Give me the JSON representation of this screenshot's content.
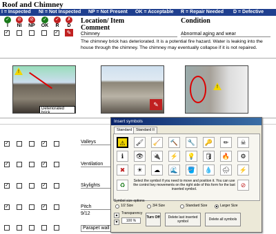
{
  "title": "Roof and Chimney",
  "legend": [
    "I = Inspected",
    "NI = Not Inspected",
    "NP = Not Present",
    "OK = Acceptable",
    "R = Repair Needed",
    "D = Defective"
  ],
  "codes": [
    {
      "label": "I",
      "color": "#1a7a1a",
      "glyph": "✓"
    },
    {
      "label": "NI",
      "color": "#c02020",
      "glyph": "⊘"
    },
    {
      "label": "NP",
      "color": "#c02020",
      "glyph": "⊘"
    },
    {
      "label": "OK",
      "color": "#1a7a1a",
      "glyph": "✓"
    },
    {
      "label": "R",
      "color": "#c02020",
      "glyph": "✓"
    },
    {
      "label": "D",
      "color": "#c02020",
      "glyph": "✗"
    }
  ],
  "headers": {
    "location": "Location/ Item",
    "condition": "Condition",
    "comment": "Comment"
  },
  "first_item": {
    "location": "Chimney",
    "condition": "Abnormal aging and wear",
    "comment": "The chimney brick has deteriorated. It is a potential fire hazard. Water is leaking into the house through the chimney. The chimney may eventually collapse if it is not repaired."
  },
  "photo_caption": "Deteriorated brick",
  "rows": [
    {
      "label": "Valleys",
      "sub": ""
    },
    {
      "label": "Ventilation",
      "sub": ""
    },
    {
      "label": "Skylights",
      "sub": ""
    },
    {
      "label": "Pitch",
      "sub": "9/12"
    }
  ],
  "parapet": "Parapet wall",
  "dialog": {
    "title": "Insert symbols",
    "tabs": [
      "Standard I",
      "Standard II"
    ],
    "instruction": "Select the symbol if you need to move and position it. You can use the control key movements on the right side of this form for the last inserted symbol.",
    "size_label": "Symbol size options",
    "sizes": [
      "1/2 Size",
      "3/4 Size",
      "Standard Size",
      "Larger Size"
    ],
    "selected_size": "Larger Size",
    "transparency_label": "Transparency",
    "transparency_value": "100 %",
    "turn_off": "Turn Off",
    "delete_last": "Delete last inserted symbol",
    "delete_all": "Delete all symbols",
    "symbols": [
      "⚠",
      "🖌",
      "🧹",
      "🔨",
      "🔧",
      "🔑",
      "✏",
      "☠",
      "ℹ",
      "👁",
      "🔌",
      "⚡",
      "💡",
      "🛢",
      "🔥",
      "⚙",
      "✖",
      "☀",
      "☁",
      "🌊",
      "🪣",
      "💧",
      "🌧",
      "⚡",
      "♻",
      "",
      "",
      "",
      "",
      "",
      "",
      ""
    ]
  },
  "colors": {
    "legend_bg": "#1f3f8f",
    "accent": "#0a246a"
  }
}
